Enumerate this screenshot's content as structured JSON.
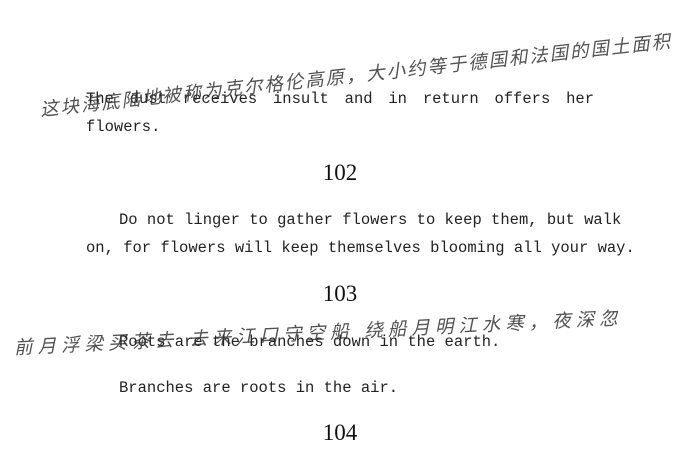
{
  "poems": [
    {
      "lines": [
        "The dust receives insult and in return offers her",
        "flowers."
      ]
    },
    {
      "number": "102",
      "lines": [
        "Do not linger to gather flowers to keep them, but walk",
        "on, for flowers will keep themselves blooming all your way."
      ]
    },
    {
      "number": "103",
      "lines": [
        "Roots are the branches down in the earth.",
        "Branches are roots in the air."
      ]
    },
    {
      "number": "104"
    }
  ],
  "handwriting": [
    "这块海底陆地被称为克尔格伦高原，大小约等于德国和法国的国土面积",
    "前月浮梁买茶去 去来江口守空船 绕船月明江水寒，夜深忽"
  ]
}
